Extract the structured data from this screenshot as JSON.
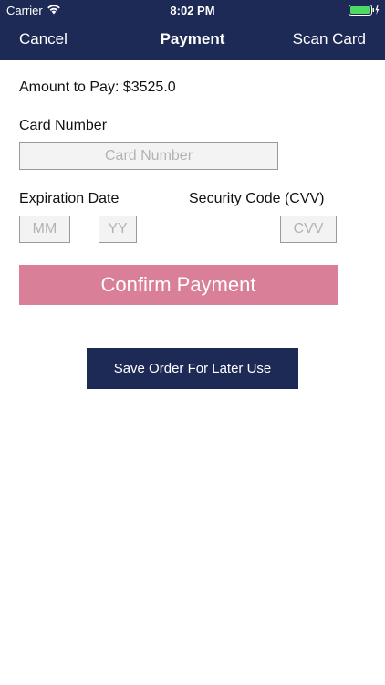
{
  "status_bar": {
    "carrier": "Carrier",
    "time": "8:02 PM",
    "wifi_icon": "wifi-icon",
    "battery_icon": "battery-icon",
    "battery_color": "#4cd964"
  },
  "nav": {
    "cancel_label": "Cancel",
    "title": "Payment",
    "scan_label": "Scan Card",
    "background_color": "#1e2a56"
  },
  "form": {
    "amount_label": "Amount to Pay: $3525.0",
    "card_number_label": "Card Number",
    "card_number_placeholder": "Card Number",
    "card_number_value": "",
    "expiration_label": "Expiration Date",
    "month_placeholder": "MM",
    "month_value": "",
    "year_placeholder": "YY",
    "year_value": "",
    "security_label": "Security Code (CVV)",
    "cvv_placeholder": "CVV",
    "cvv_value": ""
  },
  "actions": {
    "confirm_label": "Confirm Payment",
    "confirm_color": "#d97f97",
    "save_label": "Save Order For Later Use",
    "save_color": "#1e2a56"
  }
}
